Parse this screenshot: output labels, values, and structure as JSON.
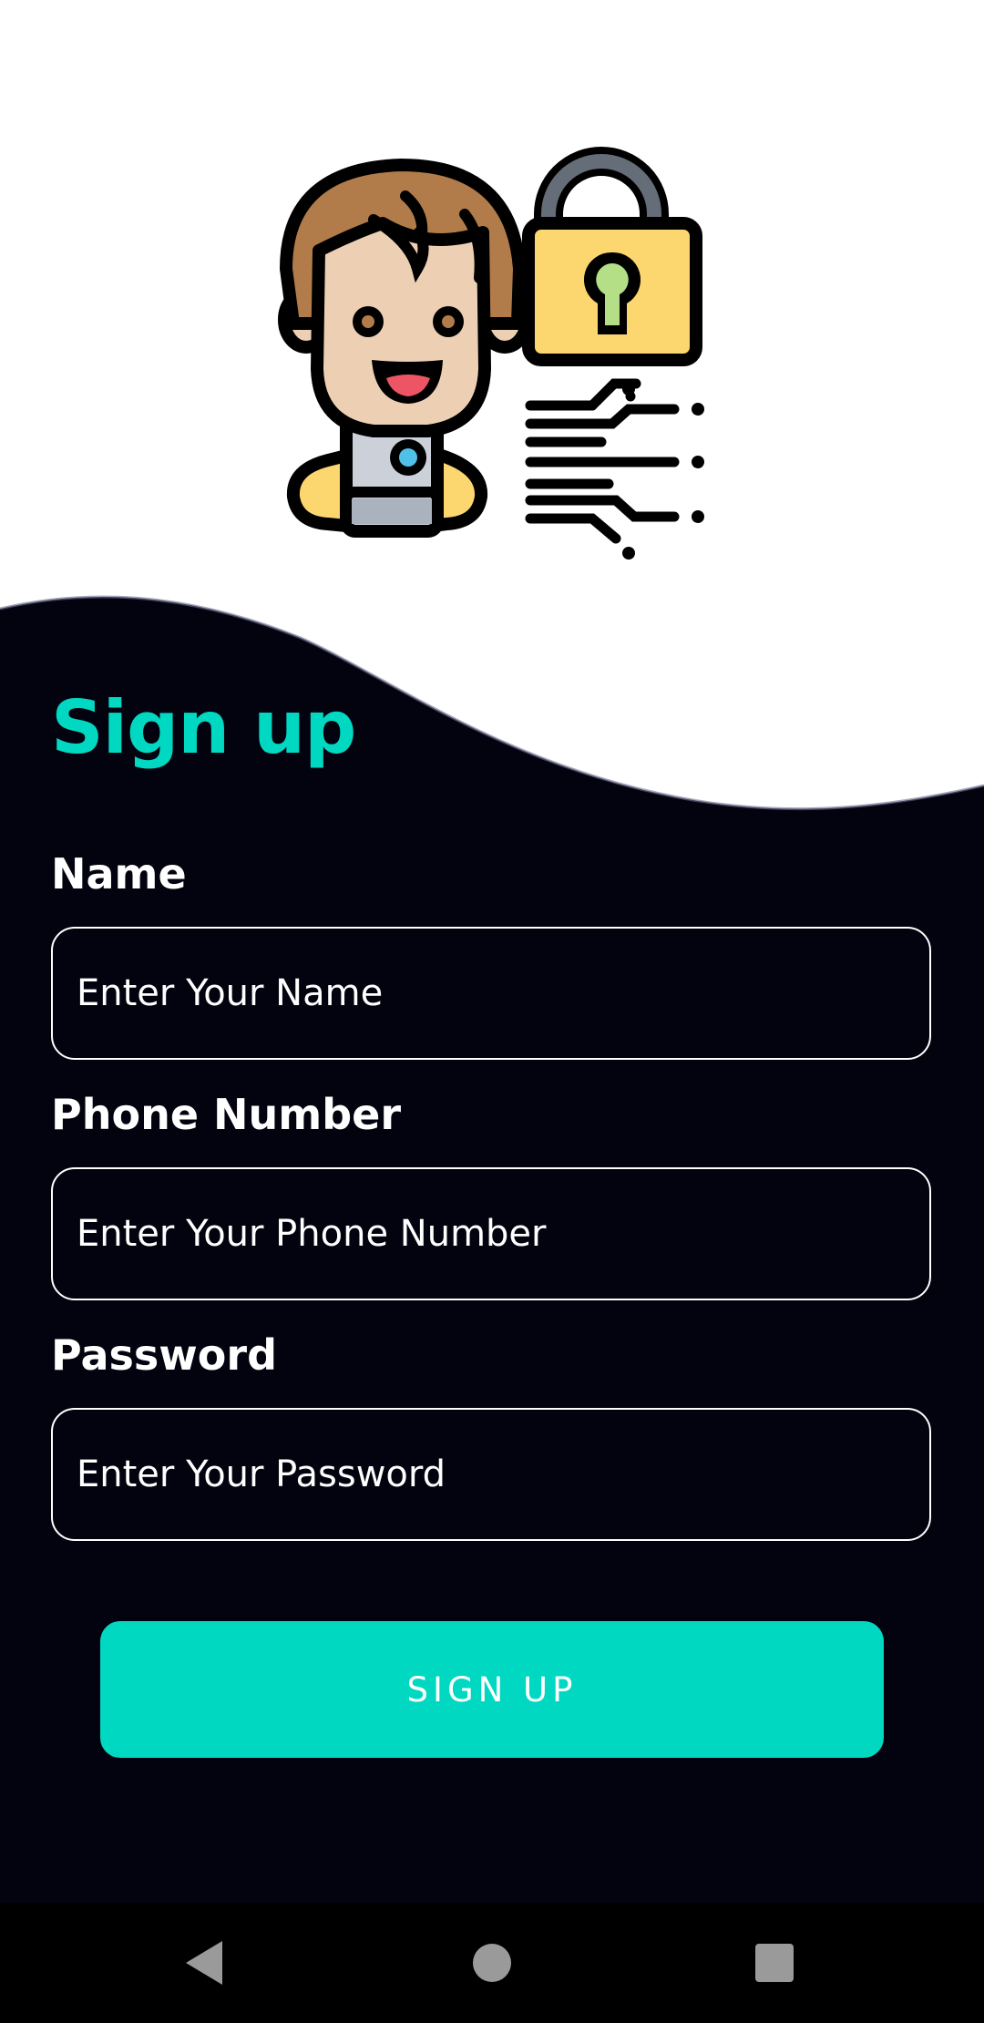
{
  "signup": {
    "title": "Sign up",
    "fields": [
      {
        "label": "Name",
        "placeholder": "Enter Your Name"
      },
      {
        "label": "Phone Number",
        "placeholder": "Enter Your Phone Number"
      },
      {
        "label": "Password",
        "placeholder": "Enter Your Password"
      }
    ],
    "submit_label": "SIGN UP"
  },
  "icons": {
    "illustration": "user-with-padlock-illustration",
    "nav": [
      "back-icon",
      "home-icon",
      "recents-icon"
    ]
  },
  "colors": {
    "background": "#03030f",
    "accent": "#00d8c2",
    "text": "#ffffff",
    "hero_background": "#ffffff"
  }
}
